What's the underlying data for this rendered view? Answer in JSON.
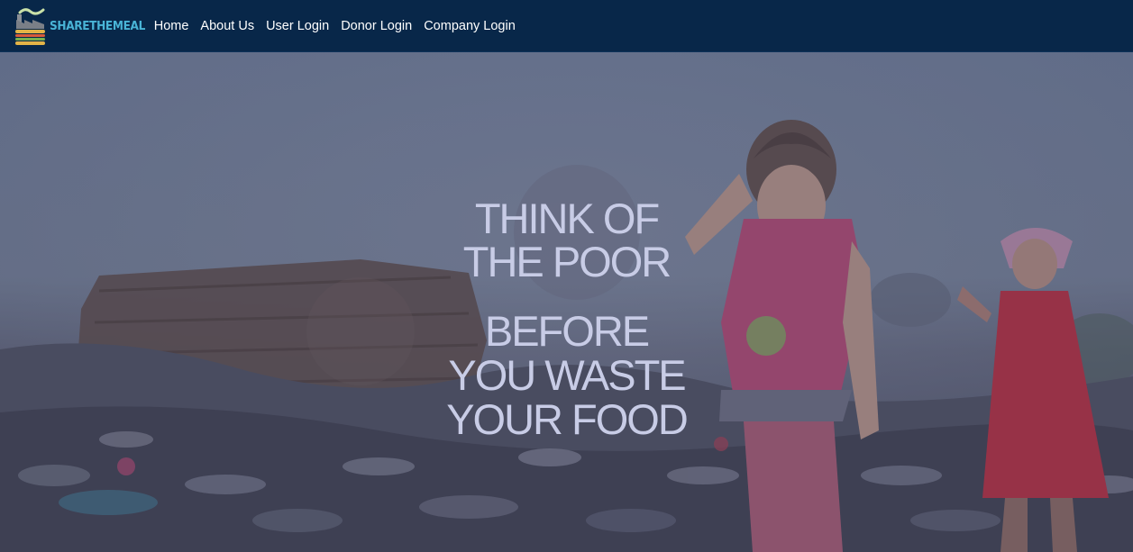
{
  "brand": {
    "name": "SHARETHEMEAL",
    "logo_icon": "burger-factory-icon"
  },
  "nav": {
    "items": [
      {
        "label": "Home"
      },
      {
        "label": "About Us"
      },
      {
        "label": "User Login"
      },
      {
        "label": "Donor Login"
      },
      {
        "label": "Company Login"
      }
    ]
  },
  "hero": {
    "headline_lines": [
      "THINK OF",
      "THE POOR",
      "BEFORE",
      "YOU WASTE",
      "YOUR FOOD"
    ]
  },
  "colors": {
    "navbar": "#082749",
    "brand_text": "#49b4d6",
    "nav_text": "#ffffff",
    "hero_text": "#c8cce6"
  }
}
